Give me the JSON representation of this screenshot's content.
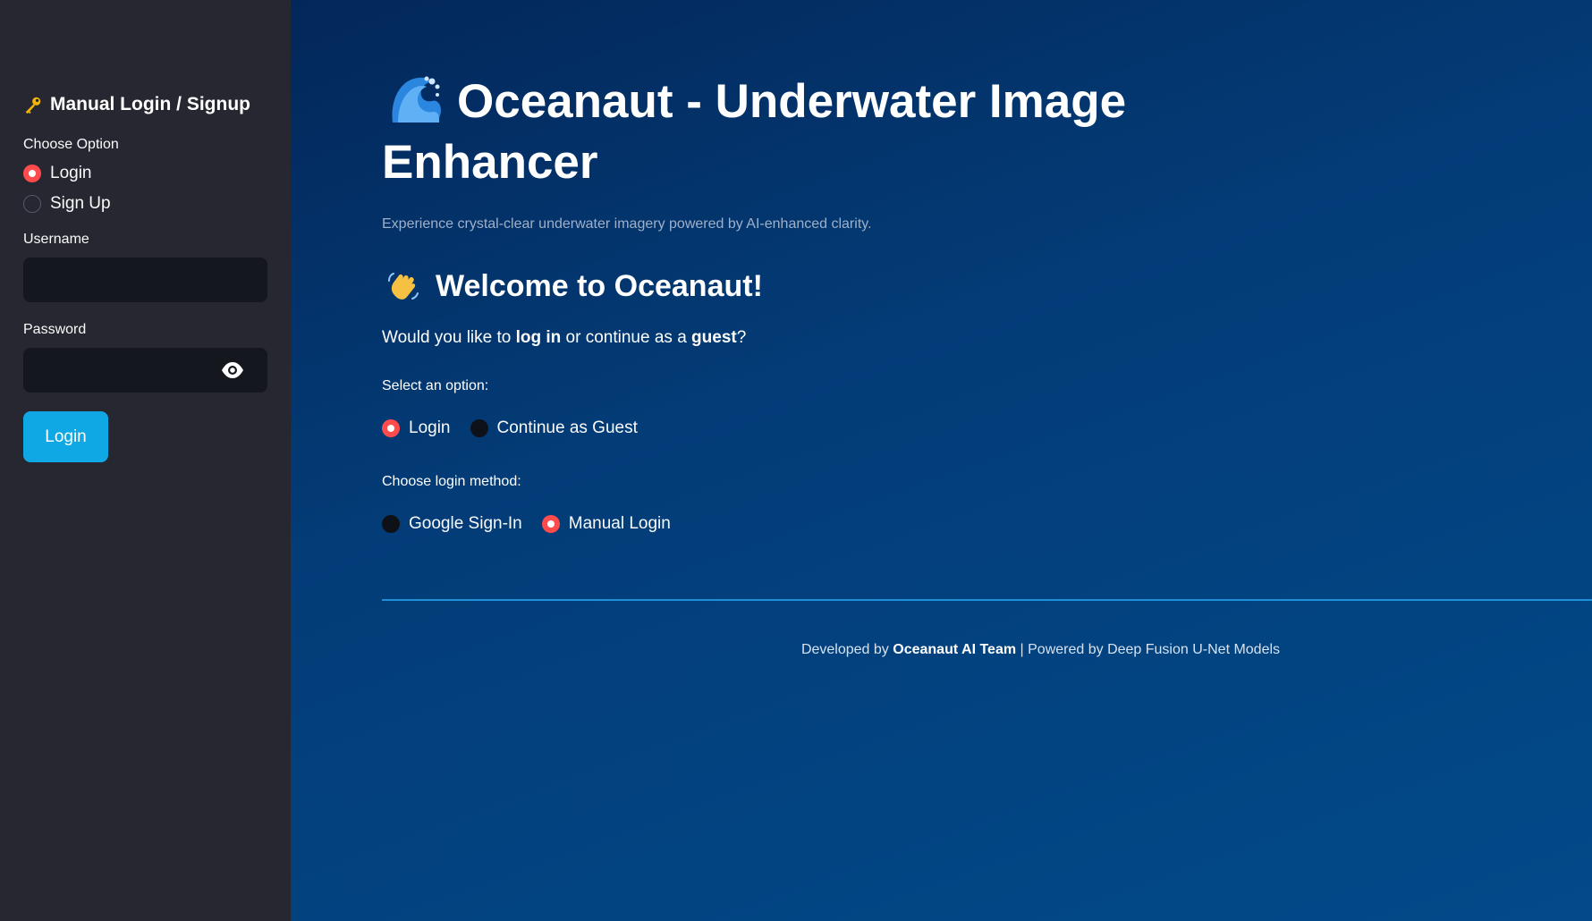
{
  "sidebar": {
    "title": "Manual Login / Signup",
    "title_icon": "key-icon",
    "choose_label": "Choose Option",
    "options": [
      {
        "label": "Login",
        "selected": true
      },
      {
        "label": "Sign Up",
        "selected": false
      }
    ],
    "username_label": "Username",
    "username_value": "",
    "password_label": "Password",
    "password_value": "",
    "login_button": "Login"
  },
  "main": {
    "title": "Oceanaut - Underwater Image Enhancer",
    "title_icon": "wave-icon",
    "subtitle": "Experience crystal-clear underwater imagery powered by AI-enhanced clarity.",
    "welcome": "Welcome to Oceanaut!",
    "welcome_icon": "waving-hand-icon",
    "question": {
      "pre": "Would you like to ",
      "b1": "log in",
      "mid": " or continue as a ",
      "b2": "guest",
      "post": "?"
    },
    "select_label": "Select an option:",
    "select_options": [
      {
        "label": "Login",
        "selected": true
      },
      {
        "label": "Continue as Guest",
        "selected": false
      }
    ],
    "method_label": "Choose login method:",
    "method_options": [
      {
        "label": "Google Sign-In",
        "selected": false
      },
      {
        "label": "Manual Login",
        "selected": true
      }
    ],
    "footer": {
      "pre": "Developed by ",
      "team": "Oceanaut AI Team",
      "post": " | Powered by Deep Fusion U-Net Models"
    }
  },
  "colors": {
    "sidebar_bg": "#262730",
    "main_bg": "#033c77",
    "radio_selected": "#ff4b4b",
    "button": "#0fa8e4",
    "divider": "#1e90d8"
  }
}
